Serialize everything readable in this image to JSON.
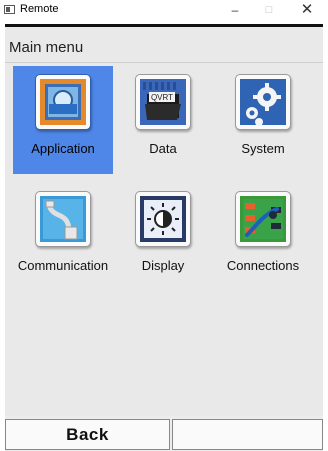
{
  "window": {
    "title": "Remote",
    "minimize_label": "–",
    "maximize_label": "□",
    "close_label": "✕"
  },
  "header": {
    "title": "Main menu"
  },
  "menu": {
    "items": [
      {
        "label": "Application",
        "icon": "application-icon",
        "selected": true
      },
      {
        "label": "Data",
        "icon": "data-folder-icon",
        "selected": false
      },
      {
        "label": "System",
        "icon": "gears-icon",
        "selected": false
      },
      {
        "label": "Communication",
        "icon": "cable-icon",
        "selected": false
      },
      {
        "label": "Display",
        "icon": "brightness-icon",
        "selected": false
      },
      {
        "label": "Connections",
        "icon": "connections-icon",
        "selected": false
      }
    ]
  },
  "footer": {
    "back_label": "Back",
    "right_label": ""
  },
  "colors": {
    "selection": "#4f87e8",
    "background": "#e9e9e9"
  }
}
